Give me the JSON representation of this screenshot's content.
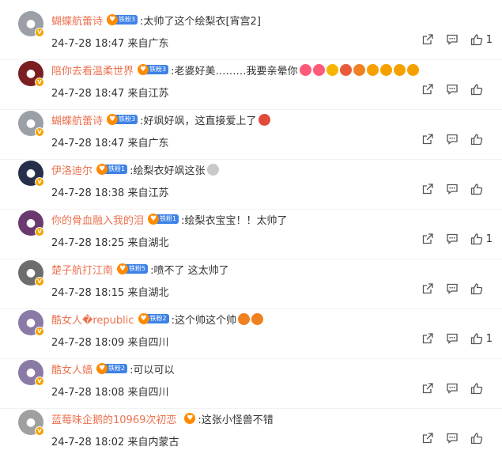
{
  "comments": [
    {
      "username": "蝴蝶航蕾诗",
      "fan_badge": "铁粉3",
      "text": ":太帅了这个绘梨衣[宵宫2]",
      "emojis": [],
      "time": "24-7-28 18:47",
      "location": "来自广东",
      "likes": "1",
      "avatar_color": "#9aa0a6"
    },
    {
      "username": "陪你去看温柔世界",
      "fan_badge": "铁粉3",
      "text": ":老婆好美………我要亲晕你",
      "emojis": [
        "#ff5a7a",
        "#ff5a7a",
        "#f6b500",
        "#e85b3b",
        "#f08020",
        "#f6a000",
        "#f6a000",
        "#f6a000",
        "#f6a000"
      ],
      "time": "24-7-28 18:47",
      "location": "来自江苏",
      "likes": "",
      "avatar_color": "#7b1e22"
    },
    {
      "username": "蝴蝶航蕾诗",
      "fan_badge": "铁粉3",
      "text": ":好飒好飒，这直接爱上了",
      "emojis": [
        "#e04b3b"
      ],
      "time": "24-7-28 18:47",
      "location": "来自广东",
      "likes": "",
      "avatar_color": "#9aa0a6"
    },
    {
      "username": "伊洛迪尔",
      "fan_badge": "铁粉1",
      "text": ":绘梨衣好飒这张",
      "emojis": [
        "#c9c9c9"
      ],
      "time": "24-7-28 18:38",
      "location": "来自江苏",
      "likes": "",
      "avatar_color": "#27304a"
    },
    {
      "username": "你的骨血融入我的泪",
      "fan_badge": "铁粉1",
      "text": ":绘梨衣宝宝！！太帅了",
      "emojis": [],
      "time": "24-7-28 18:25",
      "location": "来自湖北",
      "likes": "1",
      "avatar_color": "#6a3a6e"
    },
    {
      "username": "楚子航打江南",
      "fan_badge": "铁粉5",
      "text": ":喷不了 这太帅了",
      "emojis": [],
      "time": "24-7-28 18:15",
      "location": "来自湖北",
      "likes": "",
      "avatar_color": "#6d6d6d"
    },
    {
      "username": "酷女人�republic",
      "fan_badge": "铁粉2",
      "text": ":这个帅这个帅",
      "emojis": [
        "#f08020",
        "#f08020"
      ],
      "time": "24-7-28 18:09",
      "location": "来自四川",
      "likes": "1",
      "avatar_color": "#8a7aa6"
    },
    {
      "username": "酷女人嫱",
      "fan_badge": "铁粉2",
      "text": ":可以可以",
      "emojis": [],
      "time": "24-7-28 18:08",
      "location": "来自四川",
      "likes": "",
      "avatar_color": "#8a7aa6"
    },
    {
      "username": "蓝莓味企鹅的10969次初恋",
      "fan_badge": "",
      "text": ":这张小怪兽不错",
      "emojis": [],
      "time": "24-7-28 18:02",
      "location": "来自内蒙古",
      "likes": "",
      "avatar_color": "#a0a0a0"
    }
  ],
  "icons": {
    "share": "share-icon",
    "comment": "comment-icon",
    "like": "thumbs-up-icon",
    "verified": "verified-badge-icon",
    "fan_heart": "fan-heart-icon"
  },
  "colors": {
    "username": "#eb7350",
    "fan_badge": "#3d82e6",
    "verified": "#f4a300"
  }
}
